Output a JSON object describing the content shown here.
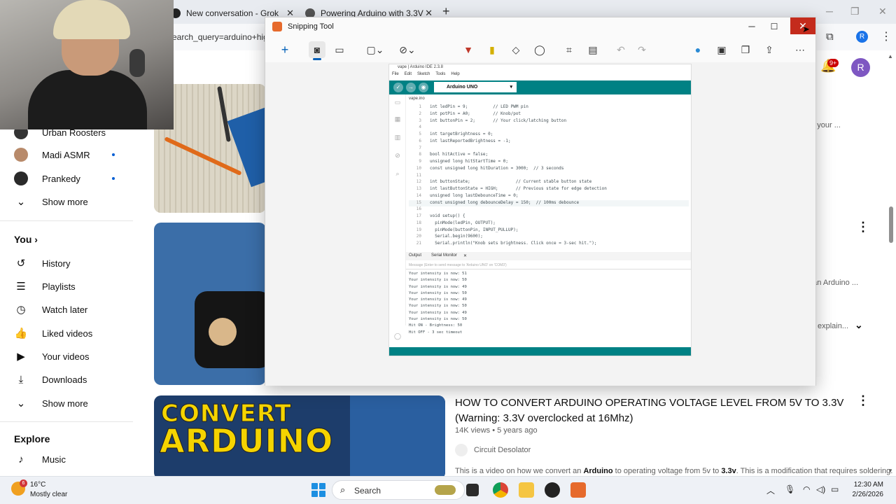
{
  "browser": {
    "tabs": [
      {
        "title": "New conversation - Grok",
        "close": "✕"
      },
      {
        "title": "Powering Arduino with 3.3V",
        "close": "✕"
      }
    ],
    "new_tab": "+",
    "url": "earch_query=arduino+hig",
    "profile_initial": "R"
  },
  "youtube": {
    "notifications_badge": "9+",
    "avatar_initial": "R",
    "subscriptions": [
      {
        "name": "Urban Roosters"
      },
      {
        "name": "Madi ASMR"
      },
      {
        "name": "Prankedy"
      }
    ],
    "show_more": "Show more",
    "you_section": "You",
    "you_items": [
      {
        "label": "History",
        "icon": "history-icon"
      },
      {
        "label": "Playlists",
        "icon": "playlists-icon"
      },
      {
        "label": "Watch later",
        "icon": "watch-later-icon"
      },
      {
        "label": "Liked videos",
        "icon": "like-icon"
      },
      {
        "label": "Your videos",
        "icon": "your-videos-icon"
      },
      {
        "label": "Downloads",
        "icon": "download-icon"
      }
    ],
    "show_more_2": "Show more",
    "explore_section": "Explore",
    "explore_items": [
      {
        "label": "Music",
        "icon": "music-icon"
      }
    ],
    "video1_desc_fragment": "ge your ...",
    "video2_desc_fragment": "d an Arduino ...",
    "video2_explain": "explain...",
    "video3": {
      "thumb_line1": "CONVERT",
      "thumb_line2": "ARDUINO",
      "title": "HOW TO CONVERT ARDUINO OPERATING VOLTAGE LEVEL FROM 5V TO 3.3V (Warning: 3.3V overclocked at 16Mhz)",
      "views": "14K views",
      "age": "5 years ago",
      "channel": "Circuit Desolator",
      "desc_parts": [
        "This is a video on how we convert an ",
        "Arduino",
        " to operating voltage from 5v to ",
        "3.3v",
        ". This is a modification that requires soldering."
      ]
    }
  },
  "snipping_tool": {
    "title": "Snipping Tool",
    "toolbar_icons": [
      "new-snip-icon",
      "camera-icon",
      "video-icon",
      "snip-mode-icon",
      "delay-icon",
      "pen-icon",
      "highlighter-icon",
      "eraser-icon",
      "shapes-icon",
      "crop-icon",
      "text-actions-icon",
      "undo-icon",
      "redo-icon",
      "edit-in-paint-icon",
      "save-icon",
      "copy-icon",
      "share-icon",
      "more-icon"
    ]
  },
  "arduino_ide": {
    "title": "vape | Arduino IDE 2.3.8",
    "menu": [
      "File",
      "Edit",
      "Sketch",
      "Tools",
      "Help"
    ],
    "board": "Arduino UNO",
    "file_tab": "vape.ino",
    "code_lines": [
      "int ledPin = 9;          // LED PWM pin",
      "int potPin = A0;         // Knob/pot",
      "int buttonPin = 2;       // Your click/latching button",
      "",
      "int targetBrightness = 0;",
      "int lastReportedBrightness = -1;",
      "",
      "bool hitActive = false;",
      "unsigned long hitStartTime = 0;",
      "const unsigned long hitDuration = 3000;  // 3 seconds",
      "",
      "int buttonState;                  // Current stable button state",
      "int lastButtonState = HIGH;       // Previous state for edge detection",
      "unsigned long lastDebounceTime = 0;",
      "const unsigned long debounceDelay = 150;  // 100ms debounce",
      "",
      "void setup() {",
      "  pinMode(ledPin, OUTPUT);",
      "  pinMode(buttonPin, INPUT_PULLUP);",
      "  Serial.begin(9600);",
      "  Serial.println(\"Knob sets brightness. Click once = 3-sec hit.\");"
    ],
    "output_tab": "Output",
    "serial_tab": "Serial Monitor",
    "serial_placeholder": "Message (Enter to send message to 'Arduino UNO' on 'COM3')",
    "serial_lines": [
      "Your intensity is now: 51",
      "Your intensity is now: 50",
      "Your intensity is now: 49",
      "Your intensity is now: 50",
      "Your intensity is now: 49",
      "Your intensity is now: 50",
      "Your intensity is now: 49",
      "Your intensity is now: 50",
      "Hit ON - Brightness: 50",
      "Hit OFF - 3 sec timeout"
    ]
  },
  "taskbar": {
    "weather_badge": "6",
    "temperature": "16°C",
    "condition": "Mostly clear",
    "search": "Search",
    "time": "12:30 AM",
    "date": "2/26/2026"
  }
}
